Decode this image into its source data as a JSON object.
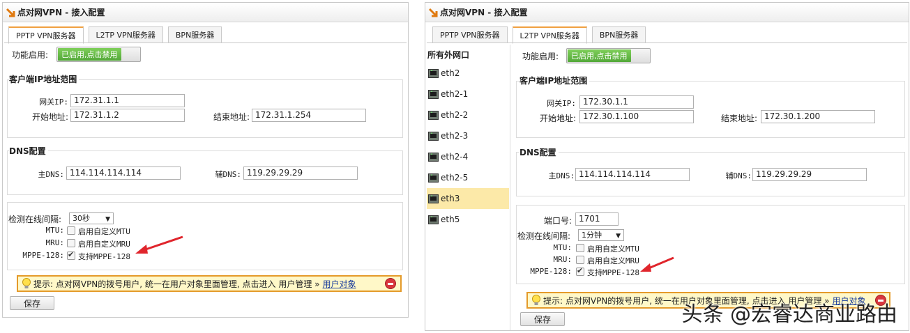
{
  "left": {
    "title": "点对网VPN - 接入配置",
    "tabs": [
      "PPTP VPN服务器",
      "L2TP VPN服务器",
      "BPN服务器"
    ],
    "enable_label": "功能启用:",
    "toggle_text": "已启用,点击禁用",
    "client_range": {
      "title": "客户端IP地址范围",
      "gateway_label": "网关IP:",
      "gateway_value": "172.31.1.1",
      "start_label": "开始地址:",
      "start_value": "172.31.1.2",
      "end_label": "结束地址:",
      "end_value": "172.31.1.254"
    },
    "dns": {
      "title": "DNS配置",
      "primary_label": "主DNS:",
      "primary_value": "114.114.114.114",
      "secondary_label": "辅DNS:",
      "secondary_value": "119.29.29.29"
    },
    "interval_label": "检测在线间隔:",
    "interval_value": "30秒",
    "mtu_label": "MTU:",
    "mtu_text": "启用自定义MTU",
    "mru_label": "MRU:",
    "mru_text": "启用自定义MRU",
    "mppe_label": "MPPE-128:",
    "mppe_text": "支持MPPE-128",
    "tip_text": "提示: 点对网VPN的拨号用户, 统一在用户对象里面管理, 点击进入 用户管理 »",
    "tip_link": "用户对象",
    "save_label": "保存"
  },
  "right": {
    "title": "点对网VPN - 接入配置",
    "tabs": [
      "PPTP VPN服务器",
      "L2TP VPN服务器",
      "BPN服务器"
    ],
    "ifaces_title": "所有外网口",
    "ifaces": [
      "eth2",
      "eth2-1",
      "eth2-2",
      "eth2-3",
      "eth2-4",
      "eth2-5",
      "eth3",
      "eth5"
    ],
    "enable_label": "功能启用:",
    "toggle_text": "已启用,点击禁用",
    "client_range": {
      "title": "客户端IP地址范围",
      "gateway_label": "网关IP:",
      "gateway_value": "172.30.1.1",
      "start_label": "开始地址:",
      "start_value": "172.30.1.100",
      "end_label": "结束地址:",
      "end_value": "172.30.1.200"
    },
    "dns": {
      "title": "DNS配置",
      "primary_label": "主DNS:",
      "primary_value": "114.114.114.114",
      "secondary_label": "辅DNS:",
      "secondary_value": "119.29.29.29"
    },
    "port_label": "端口号:",
    "port_value": "1701",
    "interval_label": "检测在线间隔:",
    "interval_value": "1分钟",
    "mtu_label": "MTU:",
    "mtu_text": "启用自定义MTU",
    "mru_label": "MRU:",
    "mru_text": "启用自定义MRU",
    "mppe_label": "MPPE-128:",
    "mppe_text": "支持MPPE-128",
    "tip_text": "提示: 点对网VPN的拨号用户, 统一在用户对象里面管理, 点击进入 用户管理 »",
    "tip_link": "用户对象",
    "save_label": "保存"
  },
  "watermark": "头条 @宏睿达商业路由",
  "colors": {
    "toggle_green": "#5cb33e",
    "tip_border": "#e49a2a",
    "tip_bg": "#fff8c8",
    "tab_accent": "#f0a040",
    "selected_iface": "#fce9a8",
    "arrow_red": "#e0252c"
  }
}
